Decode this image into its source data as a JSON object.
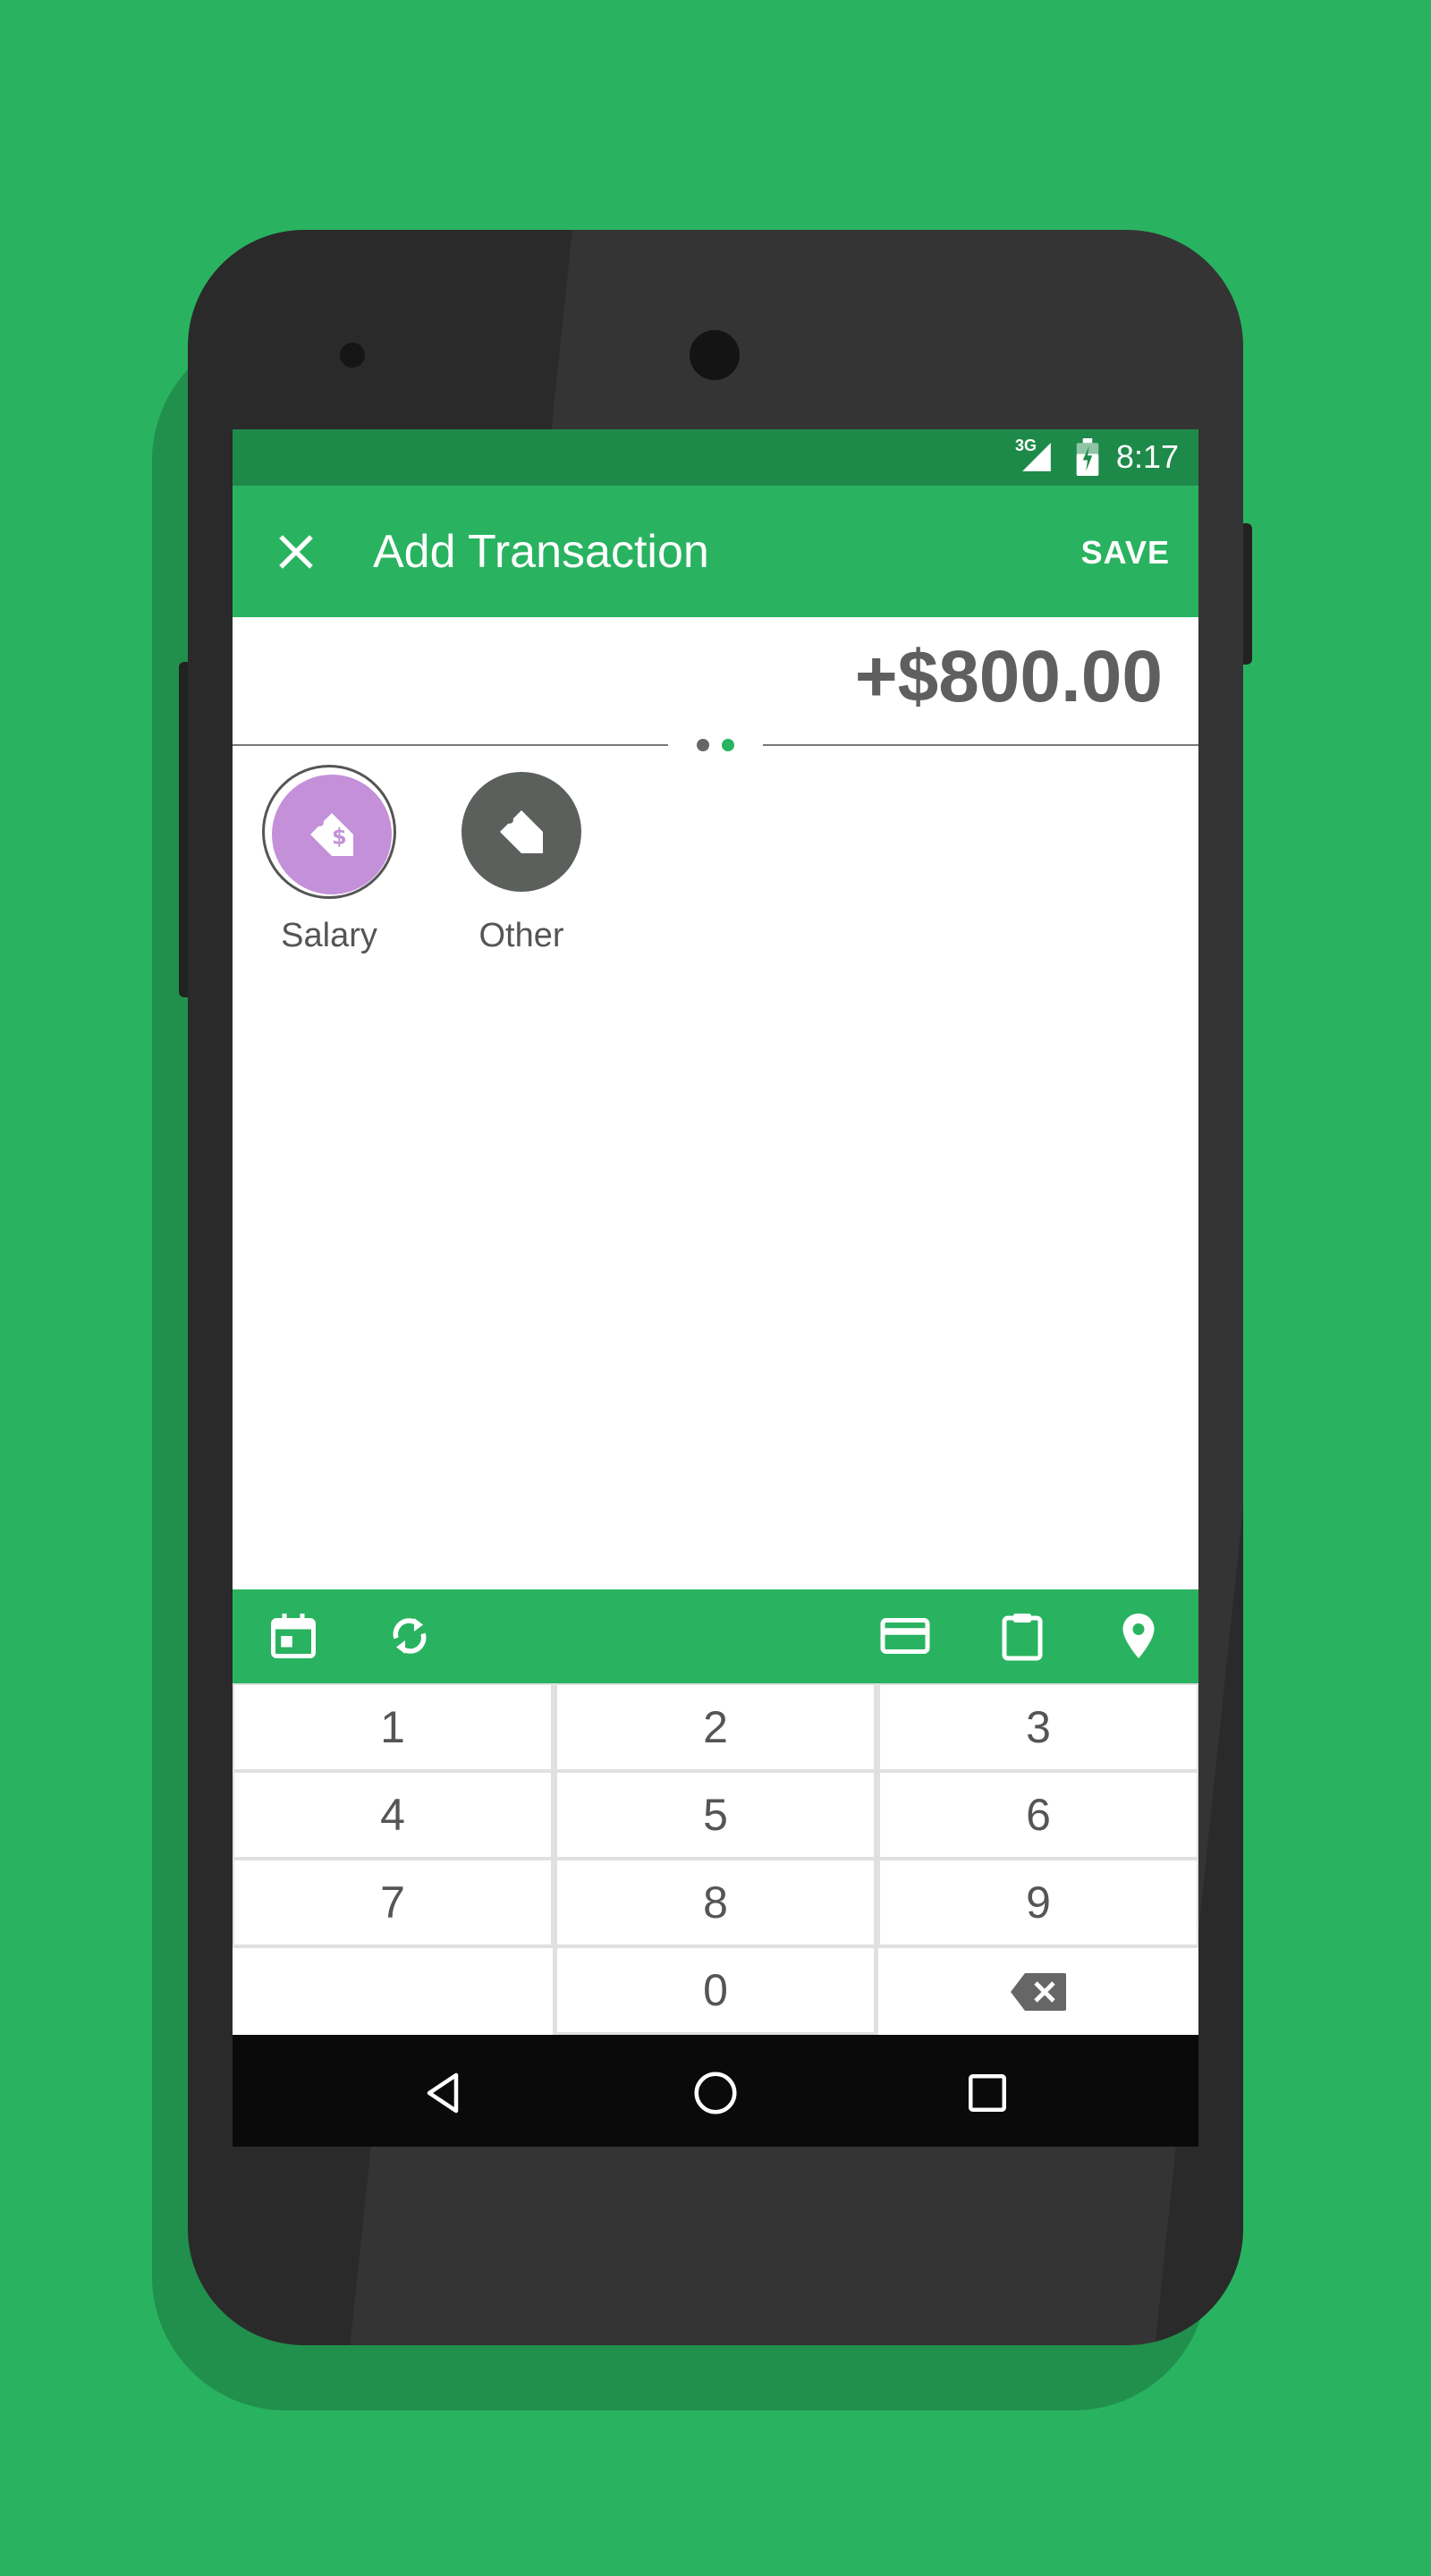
{
  "status": {
    "network": "3G",
    "time": "8:17"
  },
  "appbar": {
    "title": "Add Transaction",
    "save_label": "SAVE"
  },
  "amount": "+$800.00",
  "categories": [
    {
      "label": "Salary",
      "color": "#c490d9",
      "icon": "tag-dollar-icon",
      "selected": true
    },
    {
      "label": "Other",
      "color": "#5c605c",
      "icon": "tag-icon",
      "selected": false
    }
  ],
  "toolbar": {
    "icons": [
      "calendar-icon",
      "repeat-icon",
      "credit-card-icon",
      "clipboard-icon",
      "location-icon"
    ]
  },
  "keypad": {
    "keys": [
      "1",
      "2",
      "3",
      "4",
      "5",
      "6",
      "7",
      "8",
      "9",
      "",
      "0",
      "backspace-icon"
    ]
  },
  "colors": {
    "accent": "#29b360",
    "status_bar": "#1e8a49",
    "amount_text": "#5f5f5f"
  }
}
